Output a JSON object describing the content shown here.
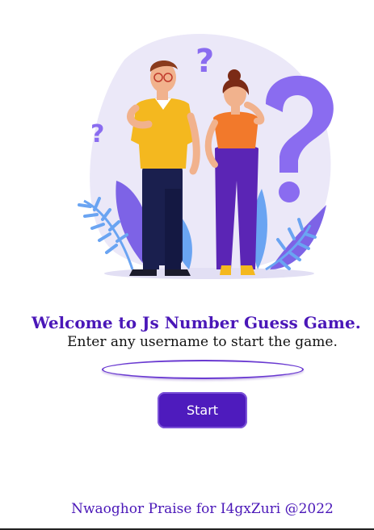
{
  "illustration": {
    "icon": "people-thinking-question-marks-illustration"
  },
  "welcome": {
    "title": "Welcome to Js Number Guess Game.",
    "subtitle": "Enter any username to start the game."
  },
  "form": {
    "username_value": "",
    "start_label": "Start"
  },
  "footer": {
    "credit": "Nwaoghor Praise for I4gxZuri @2022"
  },
  "colors": {
    "accent": "#4e1bbd",
    "title": "#4a17b8",
    "leaf": "#8a6cf0",
    "shirt": "#f4b81f",
    "top": "#f2792b"
  }
}
